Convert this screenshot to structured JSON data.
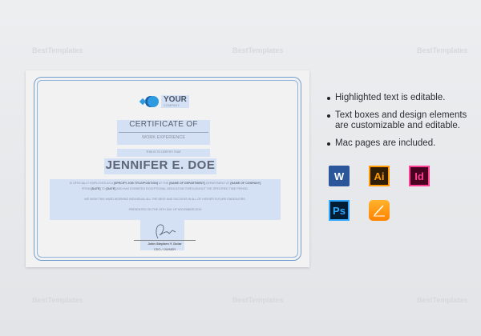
{
  "watermark": "BestTemplates",
  "certificate": {
    "logo": {
      "name": "YOUR",
      "sub": "COMPANY"
    },
    "title": "CERTIFICATE OF",
    "subtitle": "WORK EXPERIENCE",
    "certify": "THIS IS TO CERTIFY THAT",
    "recipient": "JENNIFER E. DOE",
    "body": {
      "p1a": "IS OFFICIALLY EMPLOYED AS A ",
      "job": "[SPECIFY JOB TITLE/POSITION]",
      "p1b": " AT THE ",
      "dept": "[NAME OF DEPARTMENT]",
      "p1c": " DEPARTMENT AT ",
      "company": "[NAME OF COMPANY]",
      "p2a": "FROM ",
      "date1": "[DATE]",
      "p2b": " TO ",
      "date2": "[DATE]",
      "p2c": " AND HAS EXHIBITED EXCEPTIONAL DEDICATION THROUGHOUT THE SPECIFIED TIME PERIOD.",
      "p3": "WE WISH THIS HARD WORKING INDIVIDUAL ALL THE BEST AND SUCCESS IN ALL OF HIS/HER FUTURE ENDEAVORS.",
      "p4": "PRESENTED ON THE 25TH DAY OF NOVEMBER,2019"
    },
    "signer_name": "John Stephen Y. Dolor",
    "signer_role": "CEO / OWNER"
  },
  "features": [
    "Highlighted text is editable.",
    "Text boxes and design elements are customizable and editable.",
    "Mac pages are included."
  ],
  "apps": [
    {
      "icon": "word-icon",
      "label": "W",
      "bg": "#2b579a"
    },
    {
      "icon": "illustrator-icon",
      "label": "Ai",
      "bg": "#2f1d05",
      "fg": "#ff9a00"
    },
    {
      "icon": "indesign-icon",
      "label": "Id",
      "bg": "#49021f",
      "fg": "#ff3f94"
    },
    {
      "icon": "photoshop-icon",
      "label": "Ps",
      "bg": "#001d34",
      "fg": "#31a8ff"
    },
    {
      "icon": "pages-icon",
      "bg": "#ff9a00"
    }
  ],
  "colors": {
    "highlight": "#d4e0f3",
    "border": "#6f9fd2"
  }
}
